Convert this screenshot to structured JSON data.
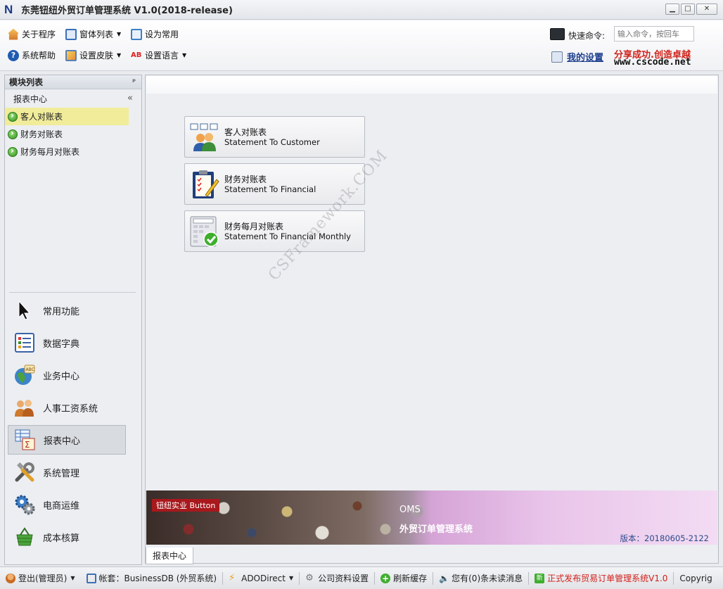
{
  "window": {
    "logo_letter": "N",
    "title": "东莞钮纽外贸订单管理系统 V1.0(2018-release)",
    "controls": [
      "▁",
      "□",
      "✕"
    ]
  },
  "toolbar": {
    "about": "关于程序",
    "window_list": "窗体列表",
    "set_common": "设为常用",
    "help": "系统帮助",
    "skin": "设置皮肤",
    "language": "设置语言",
    "quick_command_label": "快速命令:",
    "quick_command_placeholder": "输入命令，按回车",
    "my_settings": "我的设置",
    "slogan": "分享成功.创造卓越",
    "website": "www.cscode.net"
  },
  "sidebar": {
    "header": "模块列表",
    "pin_glyph": "ᵖ",
    "section": "报表中心",
    "collapse_glyph": "«",
    "tree": [
      {
        "label": "客人对账表",
        "selected": true
      },
      {
        "label": "财务对账表",
        "selected": false
      },
      {
        "label": "财务每月对账表",
        "selected": false
      }
    ],
    "nav": [
      {
        "label": "常用功能",
        "icon": "cursor-icon"
      },
      {
        "label": "数据字典",
        "icon": "list-icon"
      },
      {
        "label": "业务中心",
        "icon": "globe-icon"
      },
      {
        "label": "人事工资系统",
        "icon": "users-icon"
      },
      {
        "label": "报表中心",
        "icon": "report-icon",
        "active": true
      },
      {
        "label": "系统管理",
        "icon": "tools-icon"
      },
      {
        "label": "电商运维",
        "icon": "gears-icon"
      },
      {
        "label": "成本核算",
        "icon": "basket-icon"
      }
    ]
  },
  "main": {
    "cards": [
      {
        "cn": "客人对账表",
        "en": "Statement To Customer"
      },
      {
        "cn": "财务对账表",
        "en": "Statement To Financial"
      },
      {
        "cn": "财务每月对账表",
        "en": "Statement To Financial Monthly"
      }
    ],
    "watermark": "CSFramework.COM",
    "banner": {
      "tag": "钮纽实业 Button",
      "oms": "OMS",
      "system": "外贸订单管理系统",
      "version": "版本：20180605-2122"
    },
    "tab": "报表中心"
  },
  "statusbar": {
    "logout": "登出(管理员)",
    "account": "帐套：BusinessDB (外贸系统)",
    "ado": "ADODirect",
    "company": "公司资料设置",
    "refresh": "刷新缓存",
    "messages": "您有(0)条未读消息",
    "release": "正式发布贸易订单管理系统V1.0",
    "copyright": "Copyrig"
  },
  "colors": {
    "selected_tree": "#f1ec9a",
    "link": "#1d3f8f",
    "slogan": "#d0221a",
    "banner_tag": "#a8181c"
  }
}
